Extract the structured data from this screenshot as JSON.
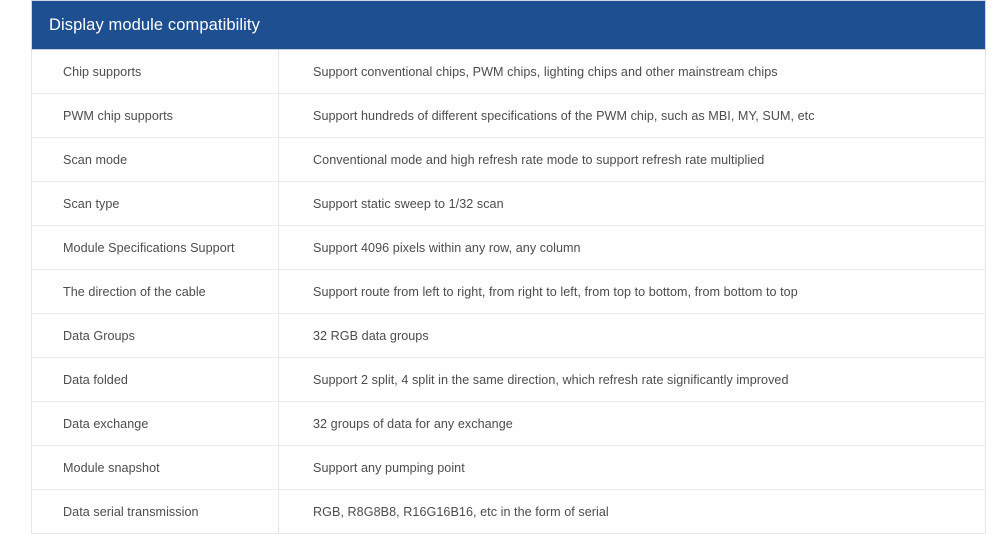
{
  "table": {
    "title": "Display module compatibility",
    "accent_color": "#1d4f91",
    "header_text_color": "#ffffff",
    "body_text_color": "#4d4d4d",
    "border_color": "#ebebeb",
    "rows": [
      {
        "label": "Chip supports",
        "value": "Support conventional chips, PWM chips, lighting chips and other mainstream chips"
      },
      {
        "label": "PWM chip supports",
        "value": "Support hundreds of different specifications of the PWM chip, such as MBI, MY, SUM, etc"
      },
      {
        "label": "Scan mode",
        "value": "Conventional mode and high refresh rate mode to support refresh rate multiplied"
      },
      {
        "label": "Scan type",
        "value": "Support static sweep to 1/32 scan"
      },
      {
        "label": "Module Specifications Support",
        "value": "Support 4096 pixels within any row, any column"
      },
      {
        "label": "The direction of the cable",
        "value": "Support route from left to right, from right to left, from top to bottom, from bottom to top"
      },
      {
        "label": "Data Groups",
        "value": "32 RGB data groups"
      },
      {
        "label": "Data folded",
        "value": "Support 2 split, 4 split in the same direction, which refresh rate significantly improved"
      },
      {
        "label": "Data exchange",
        "value": "32 groups of data for any exchange"
      },
      {
        "label": "Module snapshot",
        "value": "Support any pumping point"
      },
      {
        "label": "Data serial transmission",
        "value": "RGB, R8G8B8, R16G16B16, etc in the form of serial"
      }
    ]
  }
}
